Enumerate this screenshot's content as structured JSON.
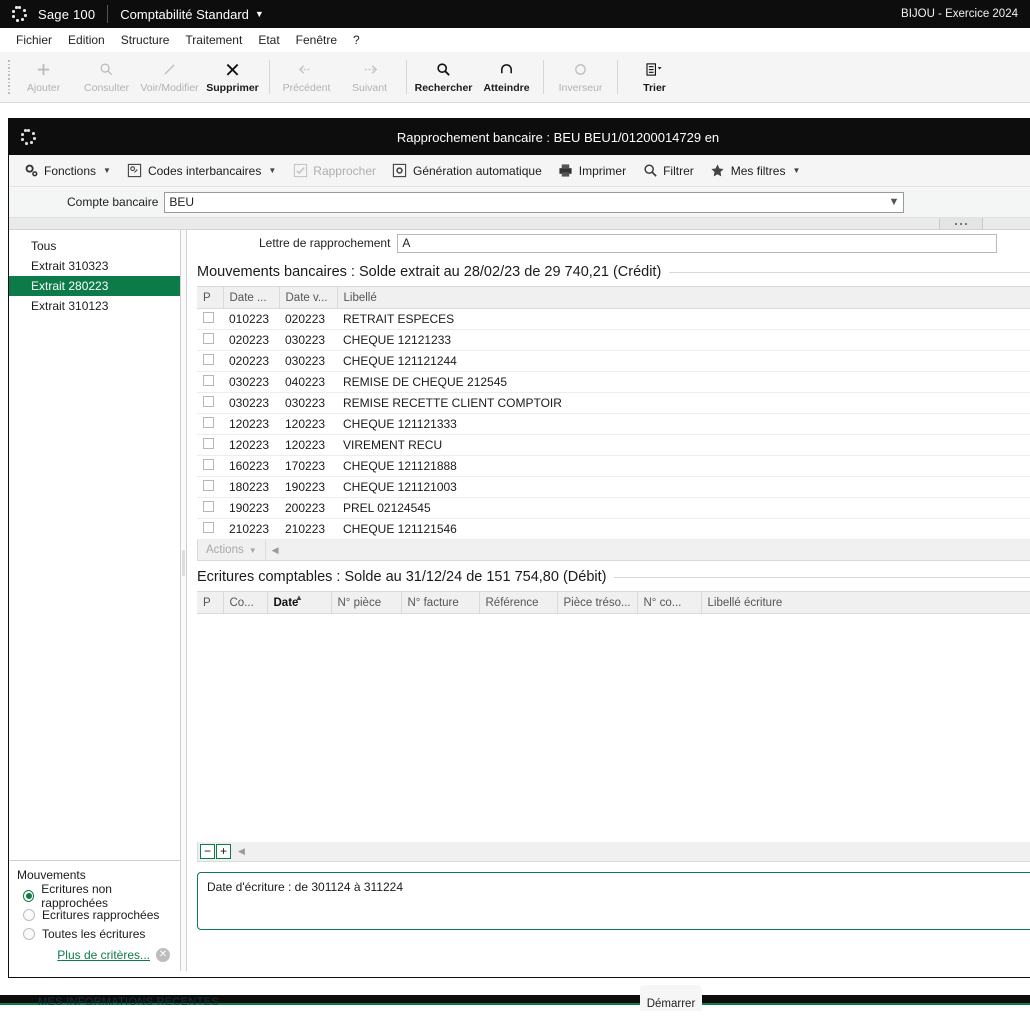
{
  "appbar": {
    "logo_icon": "sage-dots-icon",
    "brand": "Sage 100",
    "module": "Comptabilité Standard",
    "module_caret_icon": "chevron-down-icon",
    "company": "BIJOU - Exercice 2024"
  },
  "menubar": {
    "items": [
      {
        "label": "Fichier"
      },
      {
        "label": "Edition"
      },
      {
        "label": "Structure"
      },
      {
        "label": "Traitement"
      },
      {
        "label": "Etat"
      },
      {
        "label": "Fenêtre"
      },
      {
        "label": "?"
      }
    ]
  },
  "ribbon": {
    "buttons": [
      {
        "label": "Ajouter",
        "icon": "plus-icon",
        "glyph": "➕",
        "enabled": false
      },
      {
        "label": "Consulter",
        "icon": "magnifier-icon",
        "glyph": "⚲",
        "enabled": false
      },
      {
        "label": "Voir/Modifier",
        "icon": "pencil-icon",
        "glyph": "╱",
        "enabled": false
      },
      {
        "label": "Supprimer",
        "icon": "close-x-icon",
        "glyph": "✖",
        "enabled": true
      },
      {
        "sep": true
      },
      {
        "label": "Précédent",
        "icon": "arrow-left-icon",
        "glyph": "⇦",
        "enabled": false
      },
      {
        "label": "Suivant",
        "icon": "arrow-right-icon",
        "glyph": "⇨",
        "enabled": false
      },
      {
        "sep": true
      },
      {
        "label": "Rechercher",
        "icon": "search-icon",
        "glyph": "⚲",
        "enabled": true
      },
      {
        "label": "Atteindre",
        "icon": "goto-arrow-icon",
        "glyph": "↶",
        "enabled": true
      },
      {
        "sep": true
      },
      {
        "label": "Inverseur",
        "icon": "refresh-icon",
        "glyph": "⟳",
        "enabled": false
      },
      {
        "sep": true
      },
      {
        "label": "Trier",
        "icon": "sort-list-icon",
        "glyph": "☰",
        "enabled": true,
        "caret": true
      }
    ]
  },
  "window": {
    "icon": "sage-dots-icon",
    "title": "Rapprochement bancaire : BEU BEU1/01200014729 en"
  },
  "commandbar": {
    "items": [
      {
        "label": "Fonctions",
        "icon": "gears-icon",
        "glyph": "⚙",
        "caret": true,
        "enabled": true
      },
      {
        "label": "Codes interbancaires",
        "icon": "code-badge-icon",
        "glyph": "⊞",
        "caret": true,
        "enabled": true
      },
      {
        "label": "Rapprocher",
        "icon": "checkbox-check-icon",
        "glyph": "☑",
        "caret": false,
        "enabled": false
      },
      {
        "label": "Génération automatique",
        "icon": "gear-box-icon",
        "glyph": "⚙",
        "caret": false,
        "enabled": true
      },
      {
        "label": "Imprimer",
        "icon": "printer-icon",
        "glyph": "⎙",
        "caret": false,
        "enabled": true
      },
      {
        "label": "Filtrer",
        "icon": "search-icon",
        "glyph": "⚲",
        "caret": false,
        "enabled": true
      },
      {
        "label": "Mes filtres",
        "icon": "star-icon",
        "glyph": "★",
        "caret": true,
        "enabled": true
      }
    ]
  },
  "filterrow": {
    "label": "Compte bancaire",
    "value": "BEU",
    "placeholder": "",
    "dropdown_icon": "chevron-down-icon"
  },
  "splitter": {
    "handle_icon": "grip-dots-icon"
  },
  "sidebar": {
    "statements": [
      {
        "label": "Tous",
        "selected": false
      },
      {
        "label": "Extrait 310323",
        "selected": false
      },
      {
        "label": "Extrait 280223",
        "selected": true
      },
      {
        "label": "Extrait 310123",
        "selected": false
      }
    ],
    "criteria": {
      "title": "Mouvements",
      "options": [
        {
          "label": "Ecritures non rapprochées",
          "selected": true
        },
        {
          "label": "Ecritures rapprochées",
          "selected": false
        },
        {
          "label": "Toutes les écritures",
          "selected": false
        }
      ],
      "more_label": "Plus de critères...",
      "clear_icon": "clear-circle-icon"
    }
  },
  "lettre": {
    "label": "Lettre de rapprochement",
    "value": "A"
  },
  "bank_section": {
    "title": "Mouvements bancaires : Solde extrait au 28/02/23 de 29 740,21 (Crédit)",
    "columns": [
      "P",
      "Date ...",
      "Date v...",
      "Libellé"
    ],
    "rows": [
      {
        "checked": false,
        "date": "010223",
        "date_v": "020223",
        "libelle": "RETRAIT ESPECES"
      },
      {
        "checked": false,
        "date": "020223",
        "date_v": "030223",
        "libelle": "CHEQUE 12121233"
      },
      {
        "checked": false,
        "date": "020223",
        "date_v": "030223",
        "libelle": "CHEQUE 121121244"
      },
      {
        "checked": false,
        "date": "030223",
        "date_v": "040223",
        "libelle": "REMISE DE CHEQUE 212545"
      },
      {
        "checked": false,
        "date": "030223",
        "date_v": "030223",
        "libelle": "REMISE RECETTE CLIENT COMPTOIR"
      },
      {
        "checked": false,
        "date": "120223",
        "date_v": "120223",
        "libelle": "CHEQUE 121121333"
      },
      {
        "checked": false,
        "date": "120223",
        "date_v": "120223",
        "libelle": "VIREMENT RECU"
      },
      {
        "checked": false,
        "date": "160223",
        "date_v": "170223",
        "libelle": "CHEQUE 121121888"
      },
      {
        "checked": false,
        "date": "180223",
        "date_v": "190223",
        "libelle": "CHEQUE 121121003"
      },
      {
        "checked": false,
        "date": "190223",
        "date_v": "200223",
        "libelle": "PREL 02124545"
      },
      {
        "checked": false,
        "date": "210223",
        "date_v": "210223",
        "libelle": "CHEQUE 121121546"
      }
    ],
    "footer": {
      "actions_label": "Actions",
      "caret_icon": "chevron-down-icon",
      "scroll_left_icon": "triangle-left-icon"
    }
  },
  "ledger_section": {
    "title": "Ecritures comptables : Solde au 31/12/24 de 151 754,80 (Débit)",
    "columns": [
      {
        "label": "P",
        "sorted": false
      },
      {
        "label": "Co...",
        "sorted": false
      },
      {
        "label": "Date",
        "sorted": true
      },
      {
        "label": "N° pièce",
        "sorted": false
      },
      {
        "label": "N° facture",
        "sorted": false
      },
      {
        "label": "Référence",
        "sorted": false
      },
      {
        "label": "Pièce tréso...",
        "sorted": false
      },
      {
        "label": "N° co...",
        "sorted": false
      },
      {
        "label": "Libellé écriture",
        "sorted": false
      }
    ],
    "sort_arrow_icon": "sort-asc-icon",
    "rows": [],
    "footer": {
      "minus_label": "−",
      "minus_icon": "minus-icon",
      "plus_label": "+",
      "plus_icon": "plus-icon",
      "scroll_left_icon": "triangle-left-icon"
    }
  },
  "infobox": {
    "text": "Date d'écriture : de 301124 à 311224"
  },
  "taskbar": {
    "start_label": "Démarrer",
    "desktop_text": "MES INFORMATIONS RECENTES"
  },
  "colors": {
    "brand_green": "#0d7a49",
    "appbar_black": "#0d0d0d",
    "selection_green": "#0d7a49",
    "panel_gray": "#f5f5f5"
  }
}
